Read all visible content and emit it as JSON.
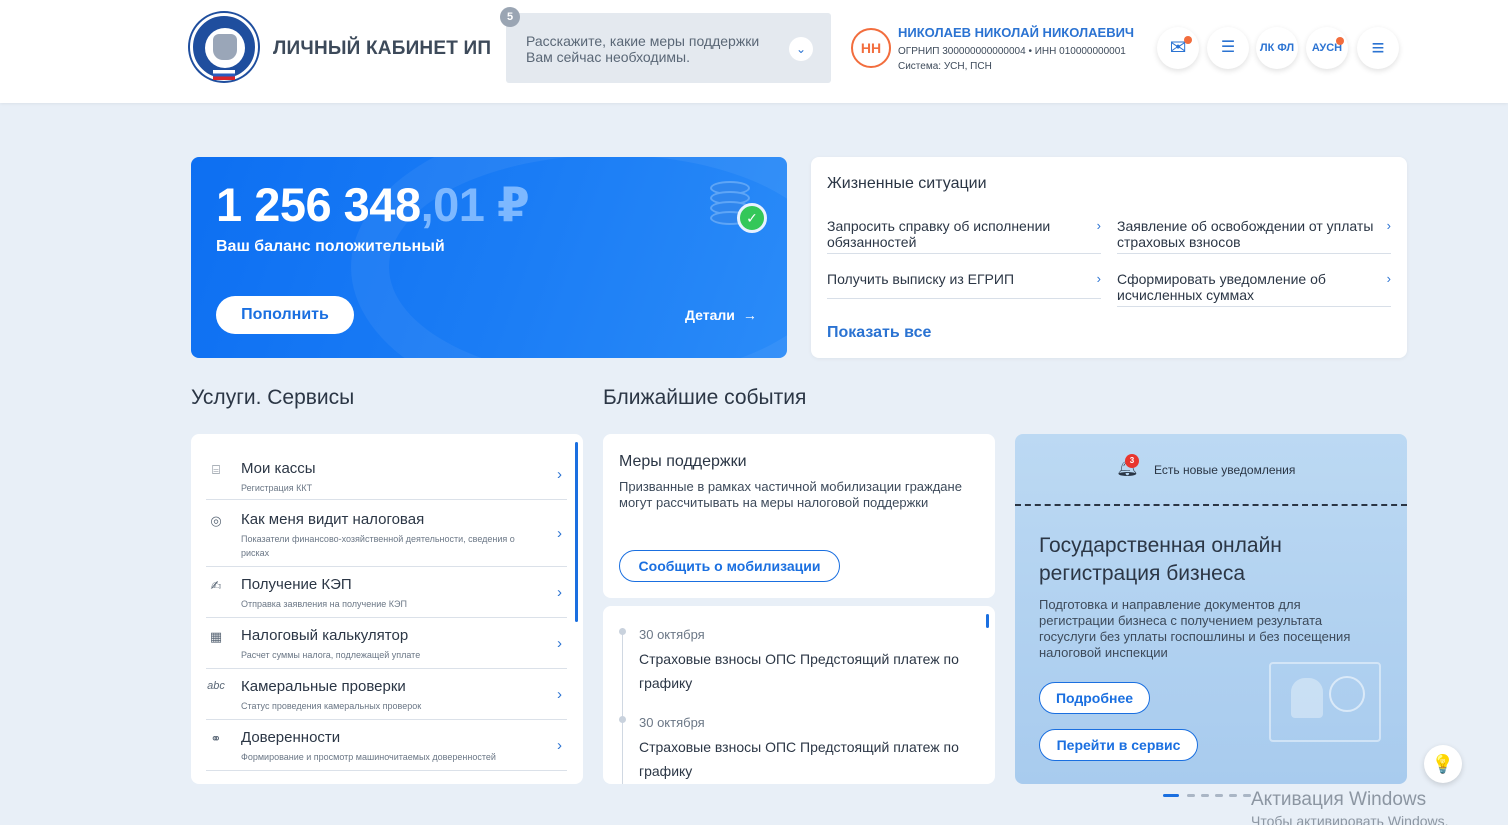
{
  "header": {
    "brand": "ЛИЧНЫЙ КАБИНЕТ ИП",
    "support": {
      "count": "5",
      "text": "Расскажите, какие меры поддержки Вам сейчас необходимы.",
      "chevron": "⌄"
    },
    "user": {
      "initials": "НН",
      "name": "НИКОЛАЕВ НИКОЛАЙ НИКОЛАЕВИЧ",
      "ogrn": "ОГРНИП 300000000000004 • ИНН 010000000001",
      "system": "Система: УСН, ПСН"
    },
    "icons": {
      "mail": "✉",
      "chat": "☰",
      "lkfl": "ЛК ФЛ",
      "ausn": "АУСН",
      "menu": "≡"
    }
  },
  "balance": {
    "integer": "1 256 348",
    "fraction": ",01 ₽",
    "label": "Ваш баланс положительный",
    "topup": "Пополнить",
    "details": "Детали",
    "details_arrow": "→"
  },
  "life": {
    "title": "Жизненные ситуации",
    "items": [
      "Запросить справку об исполнении обязанностей",
      "Заявление об освобождении от уплаты страховых взносов",
      "Получить выписку из ЕГРИП",
      "Сформировать уведомление об исчисленных суммах"
    ],
    "show_all": "Показать все",
    "chevron": "›"
  },
  "sections": {
    "services": "Услуги. Сервисы",
    "events": "Ближайшие события"
  },
  "services": [
    {
      "icon": "kkt-icon",
      "glyph": "⌸",
      "title": "Мои кассы",
      "sub": "Регистрация ККТ"
    },
    {
      "icon": "search-person-icon",
      "glyph": "◎",
      "title": "Как меня видит налоговая",
      "sub": "Показатели финансово-хозяйственной деятельности, сведения о рисках"
    },
    {
      "icon": "signature-icon",
      "glyph": "✍",
      "title": "Получение КЭП",
      "sub": "Отправка заявления на получение КЭП"
    },
    {
      "icon": "calculator-icon",
      "glyph": "▦",
      "title": "Налоговый калькулятор",
      "sub": "Расчет суммы налога, подлежащей уплате"
    },
    {
      "icon": "abc-check-icon",
      "glyph": "abc",
      "title": "Камеральные проверки",
      "sub": "Статус проведения камеральных проверок"
    },
    {
      "icon": "handshake-icon",
      "glyph": "⚭",
      "title": "Доверенности",
      "sub": "Формирование и просмотр машиночитаемых доверенностей"
    }
  ],
  "measures": {
    "title": "Меры поддержки",
    "text": "Призванные в рамках частичной мобилизации граждане могут рассчитывать на меры налоговой поддержки",
    "button": "Сообщить о мобилизации"
  },
  "events": [
    {
      "date": "30 октября",
      "text": "Страховые взносы ОПС Предстоящий платеж по графику"
    },
    {
      "date": "30 октября",
      "text": "Страховые взносы ОПС Предстоящий платеж по графику"
    }
  ],
  "promo": {
    "bell_count": "3",
    "notif": "Есть новые уведомления",
    "title": "Государственная онлайн регистрация бизнеса",
    "text": "Подготовка и направление документов для регистрации бизнеса с получением результата госуслуги без уплаты госпошлины и без посещения налоговой инспекции",
    "btn_more": "Подробнее",
    "btn_service": "Перейти в сервис"
  },
  "hint_glyph": "💡",
  "watermark": {
    "line1": "Активация Windows",
    "line2": "Чтобы активировать Windows, перейдите..."
  },
  "colors": {
    "accent": "#1a6fe0",
    "balance_bg": "#0d6ff2",
    "avatar": "#f26d3d",
    "page_bg": "#e8eff7"
  }
}
